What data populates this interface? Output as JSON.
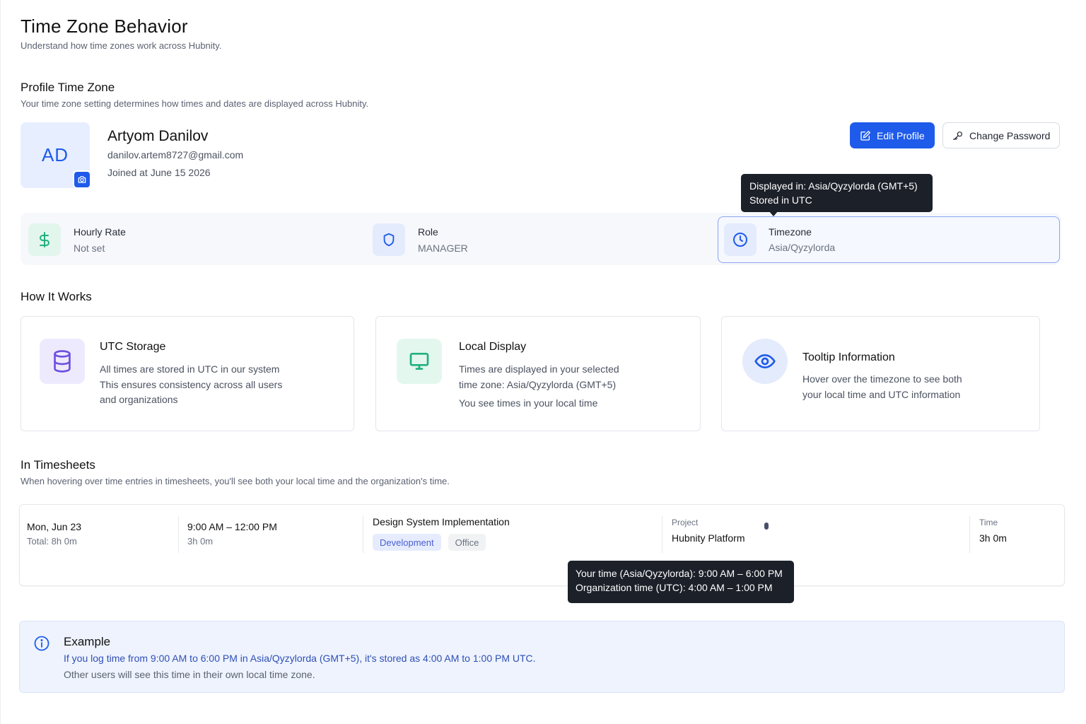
{
  "page": {
    "title": "Time Zone Behavior",
    "subtitle": "Understand how time zones work across Hubnity."
  },
  "profile_section": {
    "title": "Profile Time Zone",
    "subtitle": "Your time zone setting determines how times and dates are displayed across Hubnity."
  },
  "profile": {
    "initials": "AD",
    "name": "Artyom Danilov",
    "email": "danilov.artem8727@gmail.com",
    "joined": "Joined at June 15 2026"
  },
  "actions": {
    "edit_profile": "Edit Profile",
    "change_password": "Change Password"
  },
  "stats": {
    "hourly_rate_label": "Hourly Rate",
    "hourly_rate_value": "Not set",
    "role_label": "Role",
    "role_value": "MANAGER",
    "timezone_label": "Timezone",
    "timezone_value": "Asia/Qyzylorda"
  },
  "timezone_tooltip": {
    "line1": "Displayed in: Asia/Qyzylorda (GMT+5)",
    "line2": "Stored in UTC"
  },
  "how_it_works": {
    "title": "How It Works",
    "cards": [
      {
        "title": "UTC Storage",
        "lines": [
          "All times are stored in UTC in our system",
          "This ensures consistency across all users",
          "and organizations"
        ]
      },
      {
        "title": "Local Display",
        "lines": [
          "Times are displayed in your selected",
          "time zone: Asia/Qyzylorda (GMT+5)",
          "You see times in your local time"
        ]
      },
      {
        "title": "Tooltip Information",
        "lines": [
          "Hover over the timezone to see both",
          "your local time and UTC information"
        ]
      }
    ]
  },
  "timesheets": {
    "title": "In Timesheets",
    "subtitle": "When hovering over time entries in timesheets, you'll see both your local time and the organization's time.",
    "entry": {
      "date": "Mon, Jun 23",
      "total": "Total: 8h 0m",
      "range": "9:00 AM – 12:00 PM",
      "duration": "3h 0m",
      "task": "Design System Implementation",
      "tags": [
        "Development",
        "Office"
      ],
      "project_label": "Project",
      "project": "Hubnity Platform",
      "time_label": "Time",
      "time": "3h 0m"
    },
    "tooltip": {
      "line1": "Your time (Asia/Qyzylorda): 9:00 AM – 6:00 PM",
      "line2": "Organization time (UTC): 4:00 AM – 1:00 PM"
    }
  },
  "example": {
    "title": "Example",
    "line1": "If you log time from 9:00 AM to 6:00 PM in Asia/Qyzylorda (GMT+5), it's stored as 4:00 AM to 1:00 PM UTC.",
    "line2": "Other users will see this time in their own local time zone."
  },
  "colors": {
    "primary": "#1f5bea",
    "success": "#22b07d",
    "purple": "#6d4fe0",
    "tooltip_bg": "#1c2029"
  }
}
